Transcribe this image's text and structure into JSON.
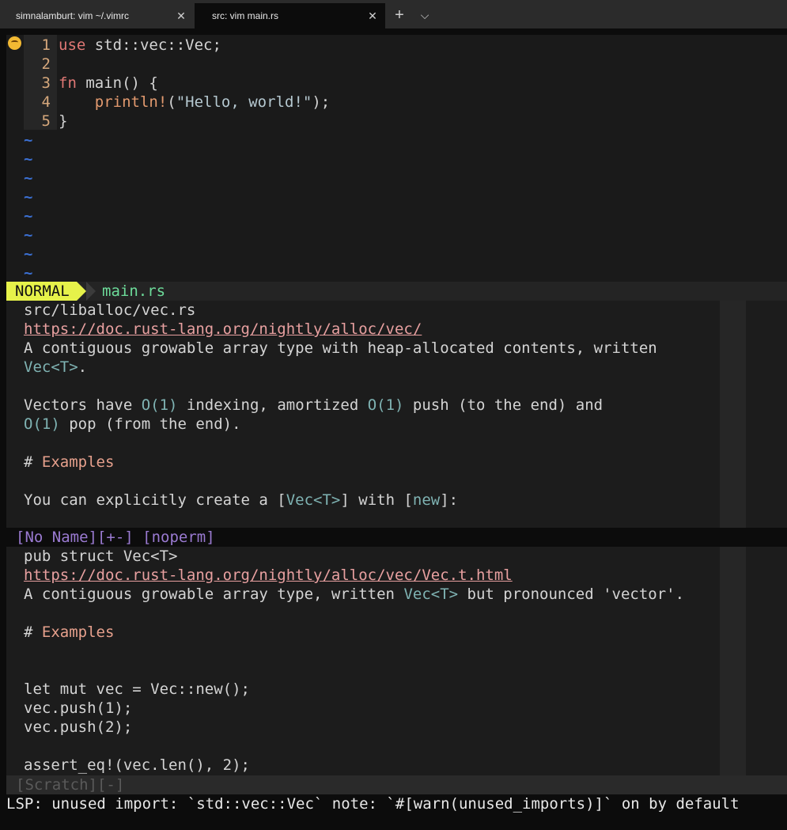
{
  "tabs": [
    {
      "label": "simnalamburt: vim ~/.vimrc",
      "close": "✕"
    },
    {
      "label": "src: vim main.rs",
      "close": "✕"
    }
  ],
  "new_tab": "+",
  "tab_menu": "⌵",
  "editor": {
    "lines": [
      {
        "num": "1",
        "parts": [
          {
            "t": "use",
            "c": "kw"
          },
          {
            "t": " std::vec::Vec;",
            "c": ""
          }
        ]
      },
      {
        "num": "2",
        "parts": []
      },
      {
        "num": "3",
        "parts": [
          {
            "t": "fn",
            "c": "kw"
          },
          {
            "t": " main() {",
            "c": ""
          }
        ]
      },
      {
        "num": "4",
        "parts": [
          {
            "t": "    ",
            "c": ""
          },
          {
            "t": "println!",
            "c": "mac"
          },
          {
            "t": "(",
            "c": ""
          },
          {
            "t": "\"Hello, world!\"",
            "c": "str"
          },
          {
            "t": ");",
            "c": ""
          }
        ]
      },
      {
        "num": "5",
        "parts": [
          {
            "t": "}",
            "c": ""
          }
        ]
      }
    ],
    "tilde_char": "~",
    "tilde_count": 8
  },
  "statusline": {
    "mode": "NORMAL",
    "filename": "main.rs"
  },
  "doc1": {
    "lines": [
      [
        {
          "t": "src/liballoc/vec.rs",
          "c": ""
        }
      ],
      [
        {
          "t": "https://doc.rust-lang.org/nightly/alloc/vec/",
          "c": "link"
        }
      ],
      [
        {
          "t": "A contiguous growable array type with heap-allocated contents, written",
          "c": ""
        }
      ],
      [
        {
          "t": "Vec<T>",
          "c": "ty"
        },
        {
          "t": ".",
          "c": ""
        }
      ],
      [],
      [
        {
          "t": "Vectors have ",
          "c": ""
        },
        {
          "t": "O(1)",
          "c": "ty"
        },
        {
          "t": " indexing, amortized ",
          "c": ""
        },
        {
          "t": "O(1)",
          "c": "ty"
        },
        {
          "t": " push (to the end) and",
          "c": ""
        }
      ],
      [
        {
          "t": "O(1)",
          "c": "ty"
        },
        {
          "t": " pop (from the end).",
          "c": ""
        }
      ],
      [],
      [
        {
          "t": "# ",
          "c": ""
        },
        {
          "t": "Examples",
          "c": "hd"
        }
      ],
      [],
      [
        {
          "t": "You can explicitly create a [",
          "c": ""
        },
        {
          "t": "Vec<T>",
          "c": "ty"
        },
        {
          "t": "] with [",
          "c": ""
        },
        {
          "t": "new",
          "c": "ty"
        },
        {
          "t": "]:",
          "c": ""
        }
      ]
    ]
  },
  "noname_status": "[No Name][+-] [noperm]",
  "doc2": {
    "lines": [
      [
        {
          "t": "pub struct Vec<T>",
          "c": ""
        }
      ],
      [
        {
          "t": "https://doc.rust-lang.org/nightly/alloc/vec/Vec.t.html",
          "c": "link"
        }
      ],
      [
        {
          "t": "A contiguous growable array type, written ",
          "c": ""
        },
        {
          "t": "Vec<T>",
          "c": "ty"
        },
        {
          "t": " but pronounced 'vector'.",
          "c": ""
        }
      ],
      [],
      [
        {
          "t": "# ",
          "c": ""
        },
        {
          "t": "Examples",
          "c": "hd"
        }
      ],
      [],
      [],
      [
        {
          "t": "let mut vec = Vec::new();",
          "c": ""
        }
      ],
      [
        {
          "t": "vec.push(1);",
          "c": ""
        }
      ],
      [
        {
          "t": "vec.push(2);",
          "c": ""
        }
      ],
      [],
      [
        {
          "t": "assert_eq!(vec.len(), 2);",
          "c": ""
        }
      ]
    ]
  },
  "scratch_status": "[Scratch][-]",
  "cmdline": "LSP: unused import: `std::vec::Vec` note: `#[warn(unused_imports)]` on by default",
  "colors": {
    "mode_bg": "#e6f24a",
    "filename": "#6ddc9a",
    "keyword": "#e07875",
    "link": "#e8a0a0",
    "type": "#7fb3b3",
    "status_purple": "#9a7ad1",
    "tilde": "#3b6fd1"
  }
}
